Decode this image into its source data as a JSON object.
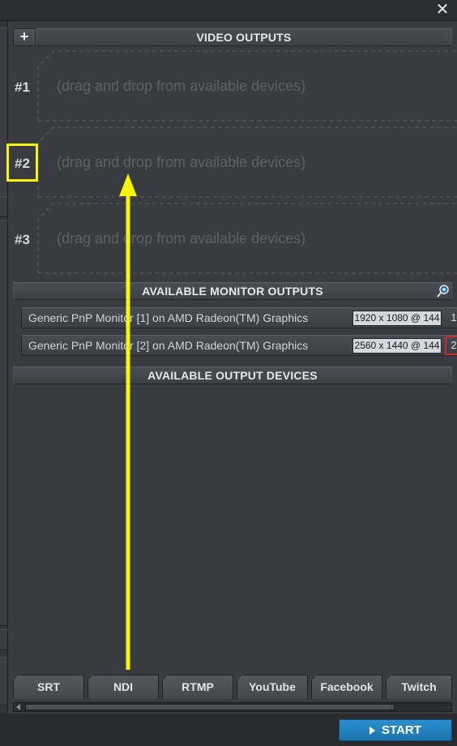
{
  "window": {
    "close_glyph": "✕"
  },
  "video_outputs": {
    "add_glyph": "+",
    "title": "VIDEO OUTPUTS",
    "slots": [
      {
        "label": "#1",
        "placeholder": "(drag and drop from available devices)"
      },
      {
        "label": "#2",
        "placeholder": "(drag and drop from available devices)"
      },
      {
        "label": "#3",
        "placeholder": "(drag and drop from available devices)"
      }
    ]
  },
  "monitor_outputs": {
    "title": "AVAILABLE MONITOR OUTPUTS",
    "rows": [
      {
        "name": "Generic PnP Monitor [1] on AMD Radeon(TM) Graphics",
        "resolution": "1920 x 1080 @ 144",
        "index": "1",
        "selected": false
      },
      {
        "name": "Generic PnP Monitor [2] on AMD Radeon(TM) Graphics",
        "resolution": "2560 x 1440 @ 144",
        "index": "2",
        "selected": true
      }
    ]
  },
  "output_devices": {
    "title": "AVAILABLE OUTPUT DEVICES"
  },
  "tabs": [
    "SRT",
    "NDI",
    "RTMP",
    "YouTube",
    "Facebook",
    "Twitch"
  ],
  "footer": {
    "start_label": "START"
  },
  "colors": {
    "highlight": "#f5f50a",
    "accent": "#2a8fcf",
    "selected_border": "#c0302a"
  },
  "icons": {
    "search": "search-plus-icon",
    "close": "close-icon",
    "play": "play-triangle-icon"
  }
}
